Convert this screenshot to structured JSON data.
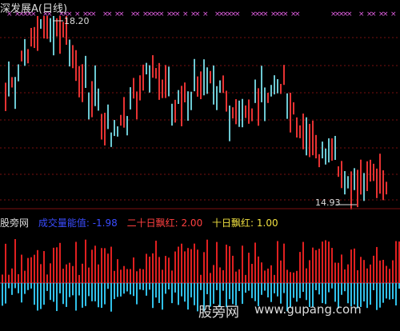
{
  "price_panel": {
    "title": "深发展A(日线)",
    "high_label": "18.20",
    "low_label": "14.93",
    "colors": {
      "up": "#e63232",
      "down": "#6cc8d2",
      "signal": "#e060e0",
      "grid": "#7a1010"
    }
  },
  "indicator_panel": {
    "name": "股旁网",
    "legend": [
      {
        "label": "成交量能值",
        "value": "-1.98",
        "color": "#3a4cff"
      },
      {
        "label": "二十日飘红",
        "value": "2.00",
        "color": "#ff4040"
      },
      {
        "label": "十日飘红",
        "value": "1.00",
        "color": "#f0e040"
      }
    ],
    "colors": {
      "pos": "#e02020",
      "neg": "#30c0e8",
      "baseline": "#b04060"
    }
  },
  "watermark": {
    "cn": "股旁网",
    "url": "www.gupang.com"
  }
}
